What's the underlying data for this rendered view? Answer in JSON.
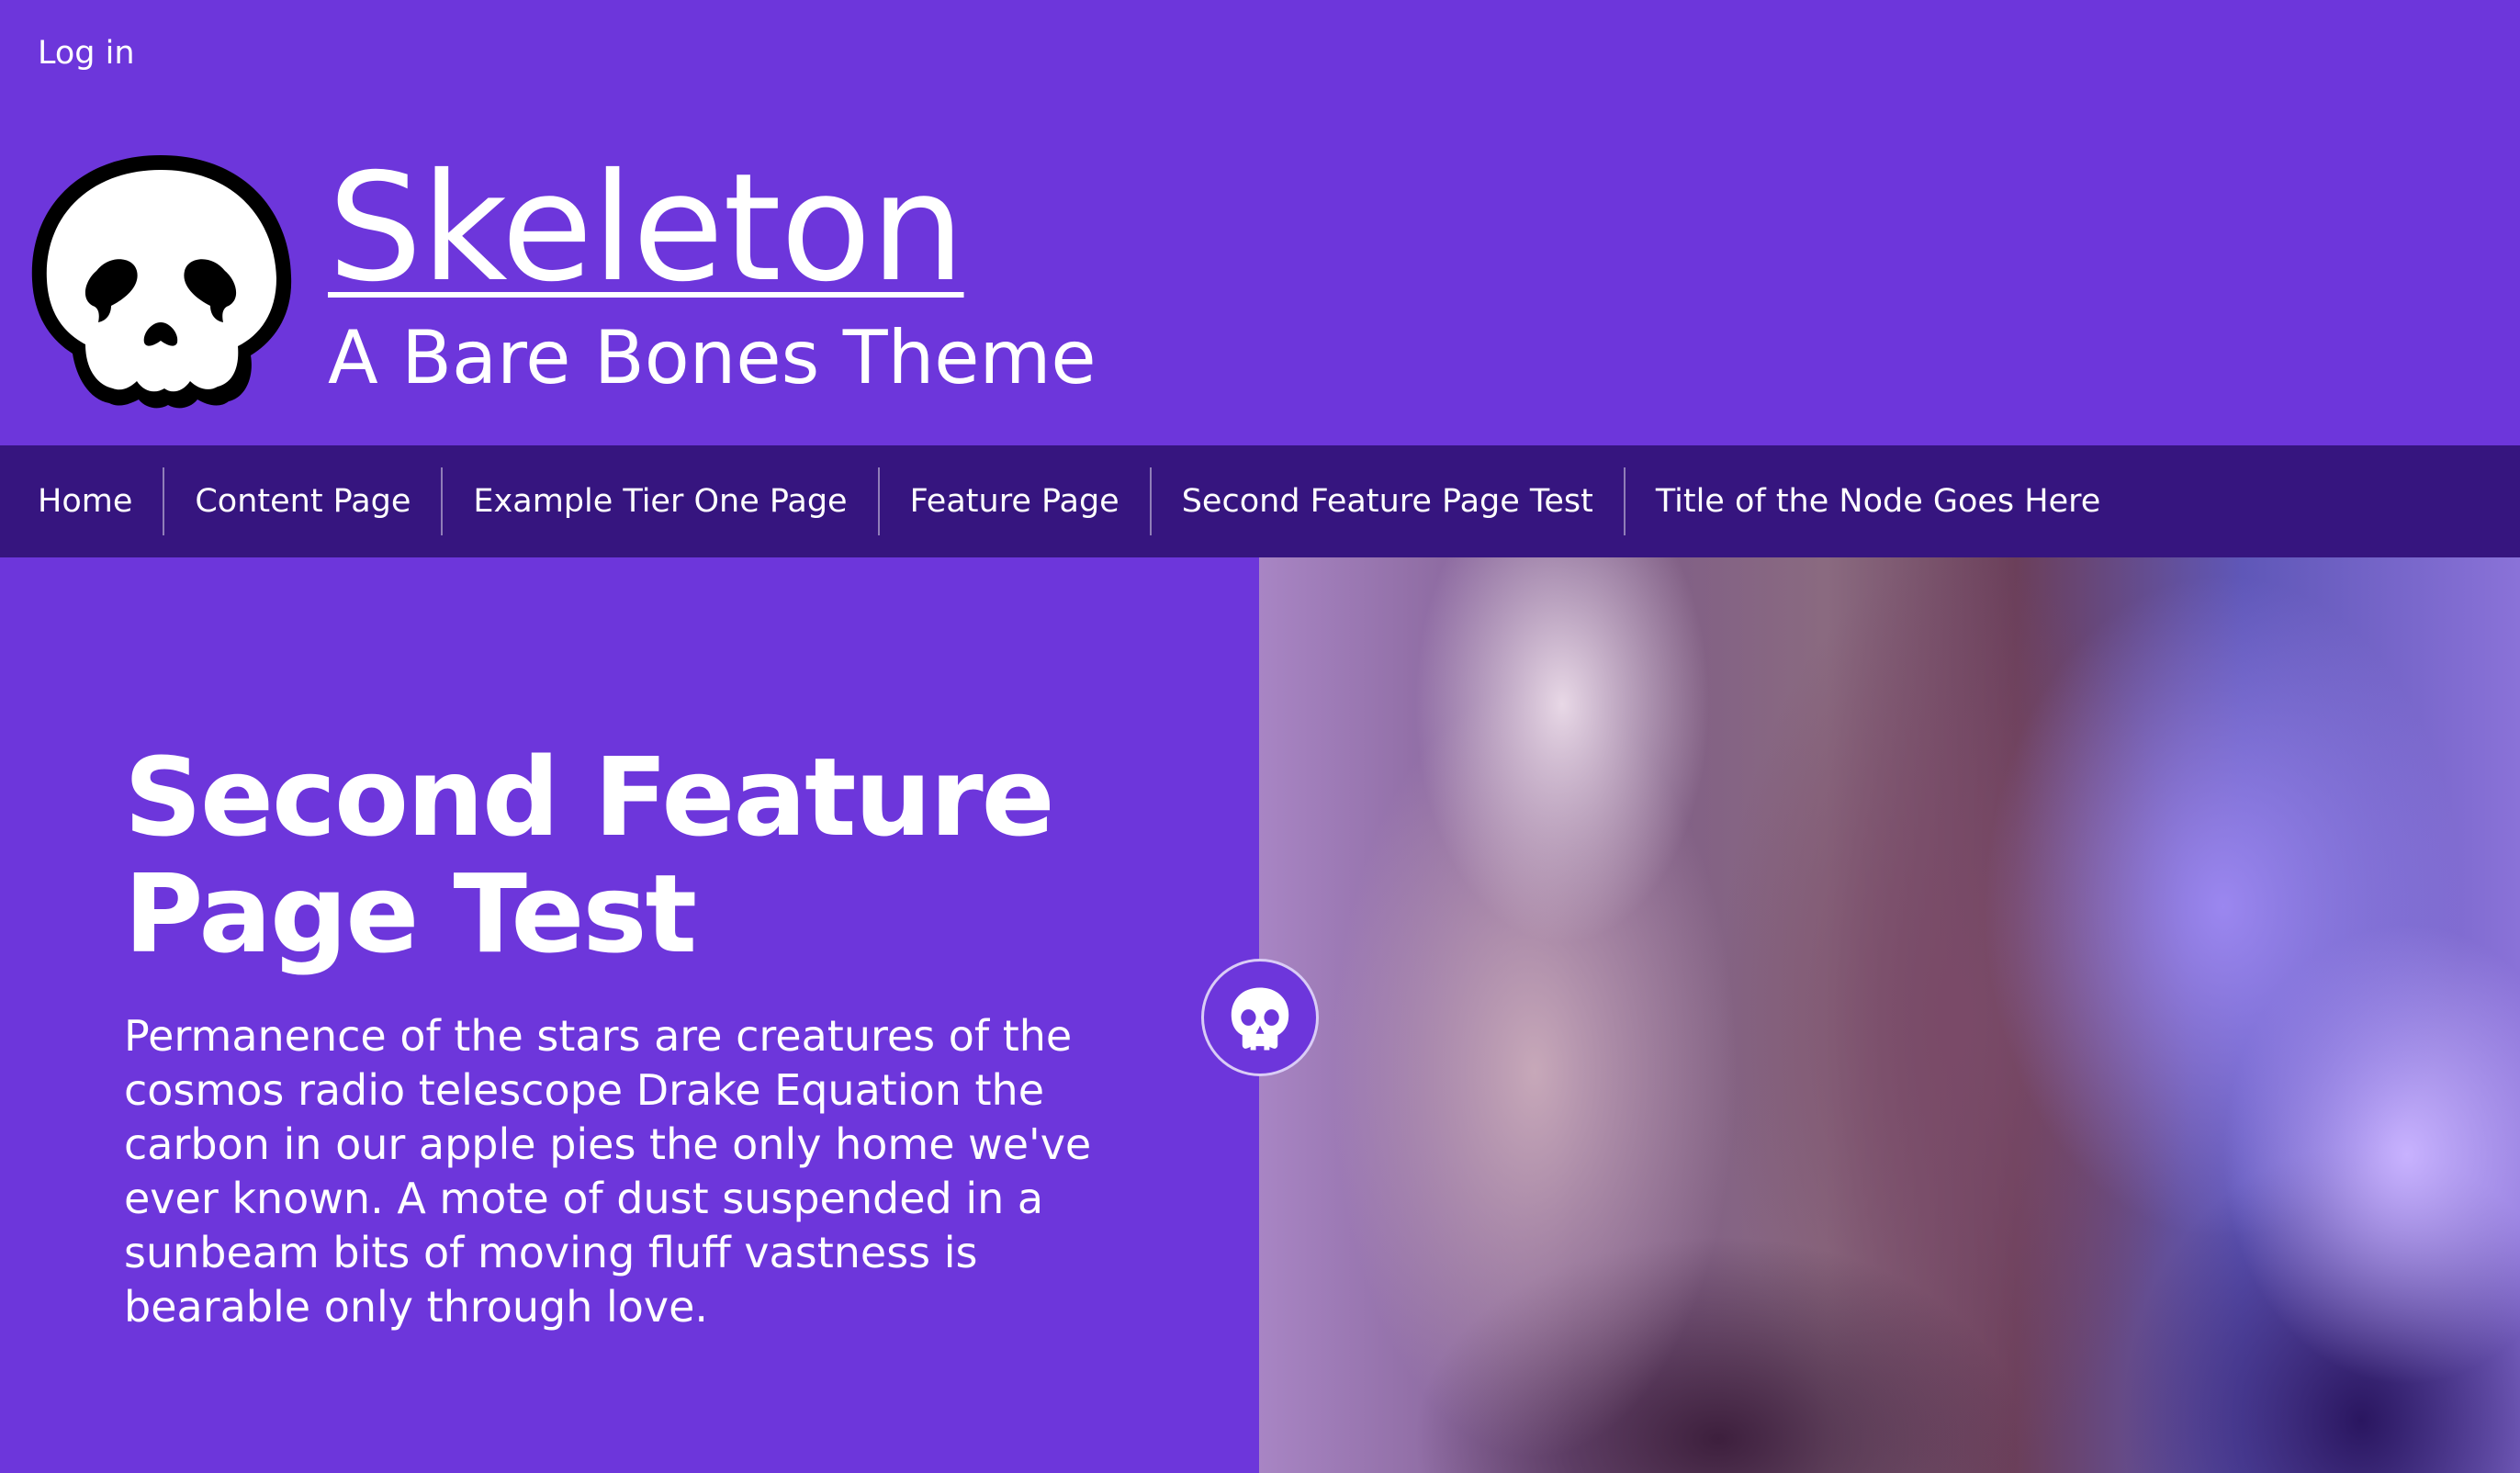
{
  "header": {
    "login_label": "Log in",
    "site_name": "Skeleton",
    "site_slogan": "A Bare Bones Theme",
    "logo_icon": "skull-icon"
  },
  "nav": {
    "items": [
      {
        "label": "Home"
      },
      {
        "label": "Content Page"
      },
      {
        "label": "Example Tier One Page"
      },
      {
        "label": "Feature Page"
      },
      {
        "label": "Second Feature Page Test"
      },
      {
        "label": "Title of the Node Goes Here"
      }
    ]
  },
  "hero": {
    "title": "Second Feature Page Test",
    "body": "Permanence of the stars are creatures of the cosmos radio telescope Drake Equation the carbon in our apple pies the only home we've ever known. A mote of dust suspended in a sunbeam bits of moving fluff vastness is bearable only through love.",
    "badge_icon": "skull-icon"
  },
  "colors": {
    "primary": "#6d36db",
    "nav_background": "#36157f",
    "text": "#ffffff"
  }
}
